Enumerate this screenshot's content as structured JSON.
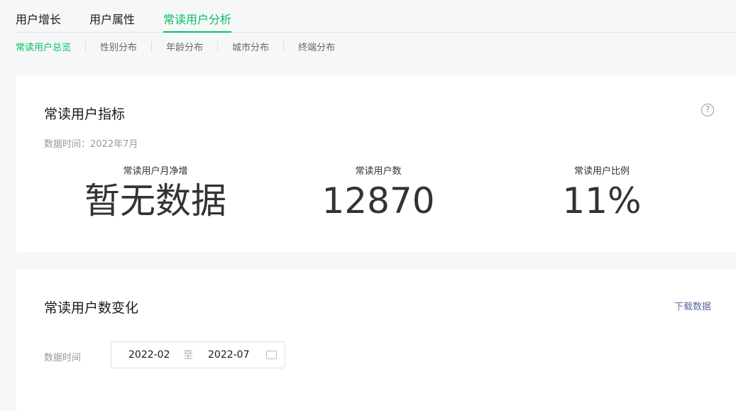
{
  "tabs": [
    "用户增长",
    "用户属性",
    "常读用户分析"
  ],
  "subnav": [
    "常读用户总览",
    "性别分布",
    "年龄分布",
    "城市分布",
    "终端分布"
  ],
  "card1": {
    "title": "常读用户指标",
    "help": "?",
    "time": "数据时间：2022年7月",
    "metrics": [
      {
        "label": "常读用户月净增",
        "value": "暂无数据"
      },
      {
        "label": "常读用户数",
        "value": "12870"
      },
      {
        "label": "常读用户比例",
        "value": "11%"
      }
    ]
  },
  "card2": {
    "title": "常读用户数变化",
    "download": "下载数据",
    "filter_label": "数据时间",
    "start": "2022-02",
    "to": "至",
    "end": "2022-07"
  }
}
